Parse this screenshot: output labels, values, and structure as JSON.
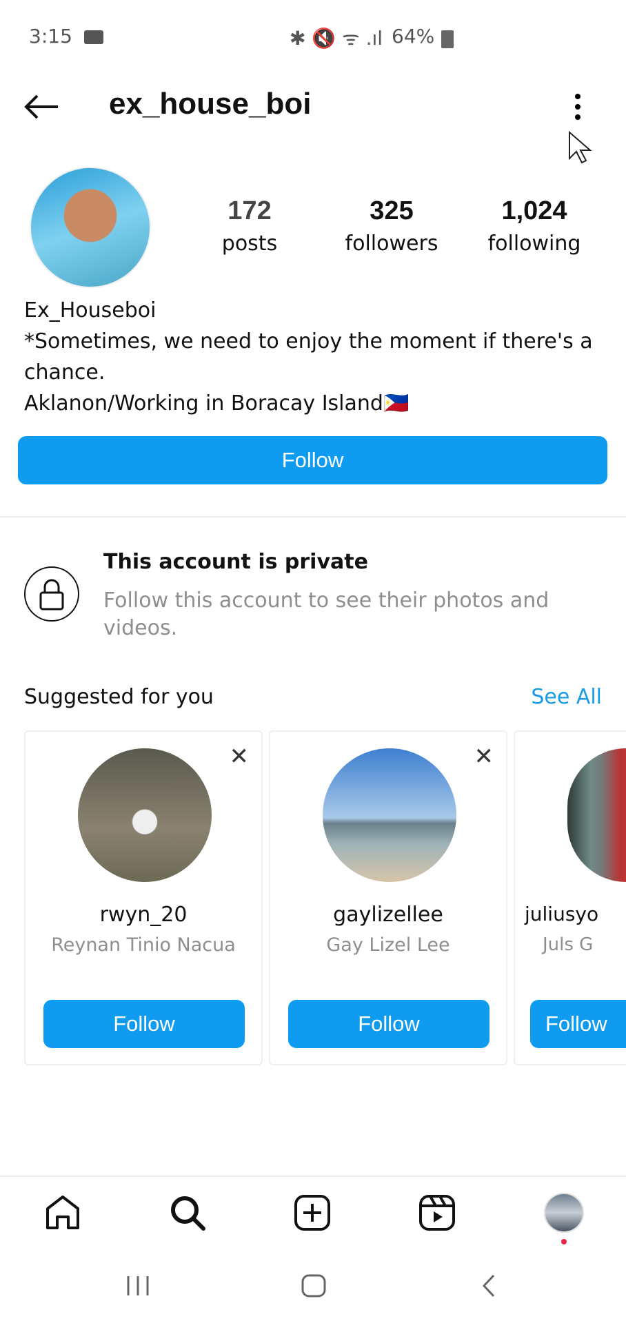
{
  "status_bar": {
    "time": "3:15",
    "battery": "64%"
  },
  "header": {
    "username": "ex_house_boi"
  },
  "stats": [
    {
      "value": "172",
      "label": "posts"
    },
    {
      "value": "325",
      "label": "followers"
    },
    {
      "value": "1,024",
      "label": "following"
    }
  ],
  "bio": {
    "name": "Ex_Houseboi",
    "lines": [
      "*Sometimes, we need to enjoy the moment if there's a chance.",
      "Aklanon/Working in Boracay Island🇵🇭"
    ]
  },
  "follow_label": "Follow",
  "private": {
    "title": "This account is private",
    "subtitle": "Follow this account to see their photos and videos."
  },
  "suggested": {
    "title": "Suggested for you",
    "see_all": "See All",
    "cards": [
      {
        "username": "rwyn_20",
        "name": "Reynan Tinio Nacua",
        "button": "Follow"
      },
      {
        "username": "gaylizellee",
        "name": "Gay Lizel Lee",
        "button": "Follow"
      },
      {
        "username": "juliusyo",
        "name": "Juls G",
        "button": "Follow"
      }
    ]
  },
  "colors": {
    "accent": "#0f9bef",
    "link": "#1a9be8"
  }
}
